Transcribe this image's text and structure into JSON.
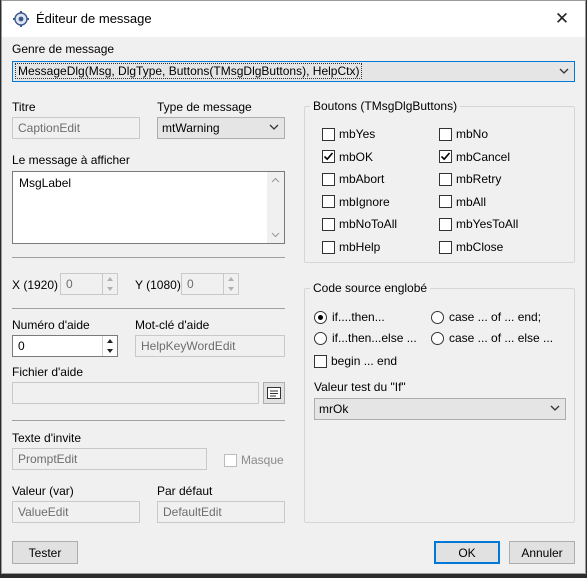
{
  "window": {
    "title": "Éditeur de message",
    "close_glyph": "✕"
  },
  "genre": {
    "label": "Genre de message",
    "value": "MessageDlg(Msg, DlgType, Buttons(TMsgDlgButtons), HelpCtx)"
  },
  "titre": {
    "label": "Titre",
    "value": "CaptionEdit"
  },
  "type_message": {
    "label": "Type de message",
    "value": "mtWarning"
  },
  "message": {
    "label": "Le message à afficher",
    "value": "MsgLabel"
  },
  "position": {
    "x_label": "X (1920)",
    "x_value": "0",
    "y_label": "Y (1080)",
    "y_value": "0"
  },
  "aide": {
    "numero_label": "Numéro d'aide",
    "numero_value": "0",
    "motcle_label": "Mot-clé d'aide",
    "motcle_value": "HelpKeyWordEdit",
    "fichier_label": "Fichier d'aide",
    "fichier_value": ""
  },
  "invite": {
    "label": "Texte d'invite",
    "value": "PromptEdit",
    "masque_label": "Masque"
  },
  "valeur": {
    "label": "Valeur (var)",
    "value": "ValueEdit",
    "defaut_label": "Par défaut",
    "defaut_value": "DefaultEdit"
  },
  "boutons": {
    "title": "Boutons (TMsgDlgButtons)",
    "items": [
      {
        "label": "mbYes",
        "checked": false
      },
      {
        "label": "mbNo",
        "checked": false
      },
      {
        "label": "mbOK",
        "checked": true
      },
      {
        "label": "mbCancel",
        "checked": true
      },
      {
        "label": "mbAbort",
        "checked": false
      },
      {
        "label": "mbRetry",
        "checked": false
      },
      {
        "label": "mbIgnore",
        "checked": false
      },
      {
        "label": "mbAll",
        "checked": false
      },
      {
        "label": "mbNoToAll",
        "checked": false
      },
      {
        "label": "mbYesToAll",
        "checked": false
      },
      {
        "label": "mbHelp",
        "checked": false
      },
      {
        "label": "mbClose",
        "checked": false
      }
    ]
  },
  "code": {
    "title": "Code source englobé",
    "radios": [
      {
        "label": "if....then...",
        "checked": true
      },
      {
        "label": "case ... of ... end;",
        "checked": false
      },
      {
        "label": "if...then...else ...",
        "checked": false
      },
      {
        "label": "case ... of ... else ...",
        "checked": false
      }
    ],
    "begin_label": "begin ... end",
    "valeur_test_label": "Valeur test du \"If\"",
    "valeur_test_value": "mrOk"
  },
  "footer": {
    "tester_label": "Tester",
    "ok_label": "OK",
    "annuler_label": "Annuler"
  }
}
